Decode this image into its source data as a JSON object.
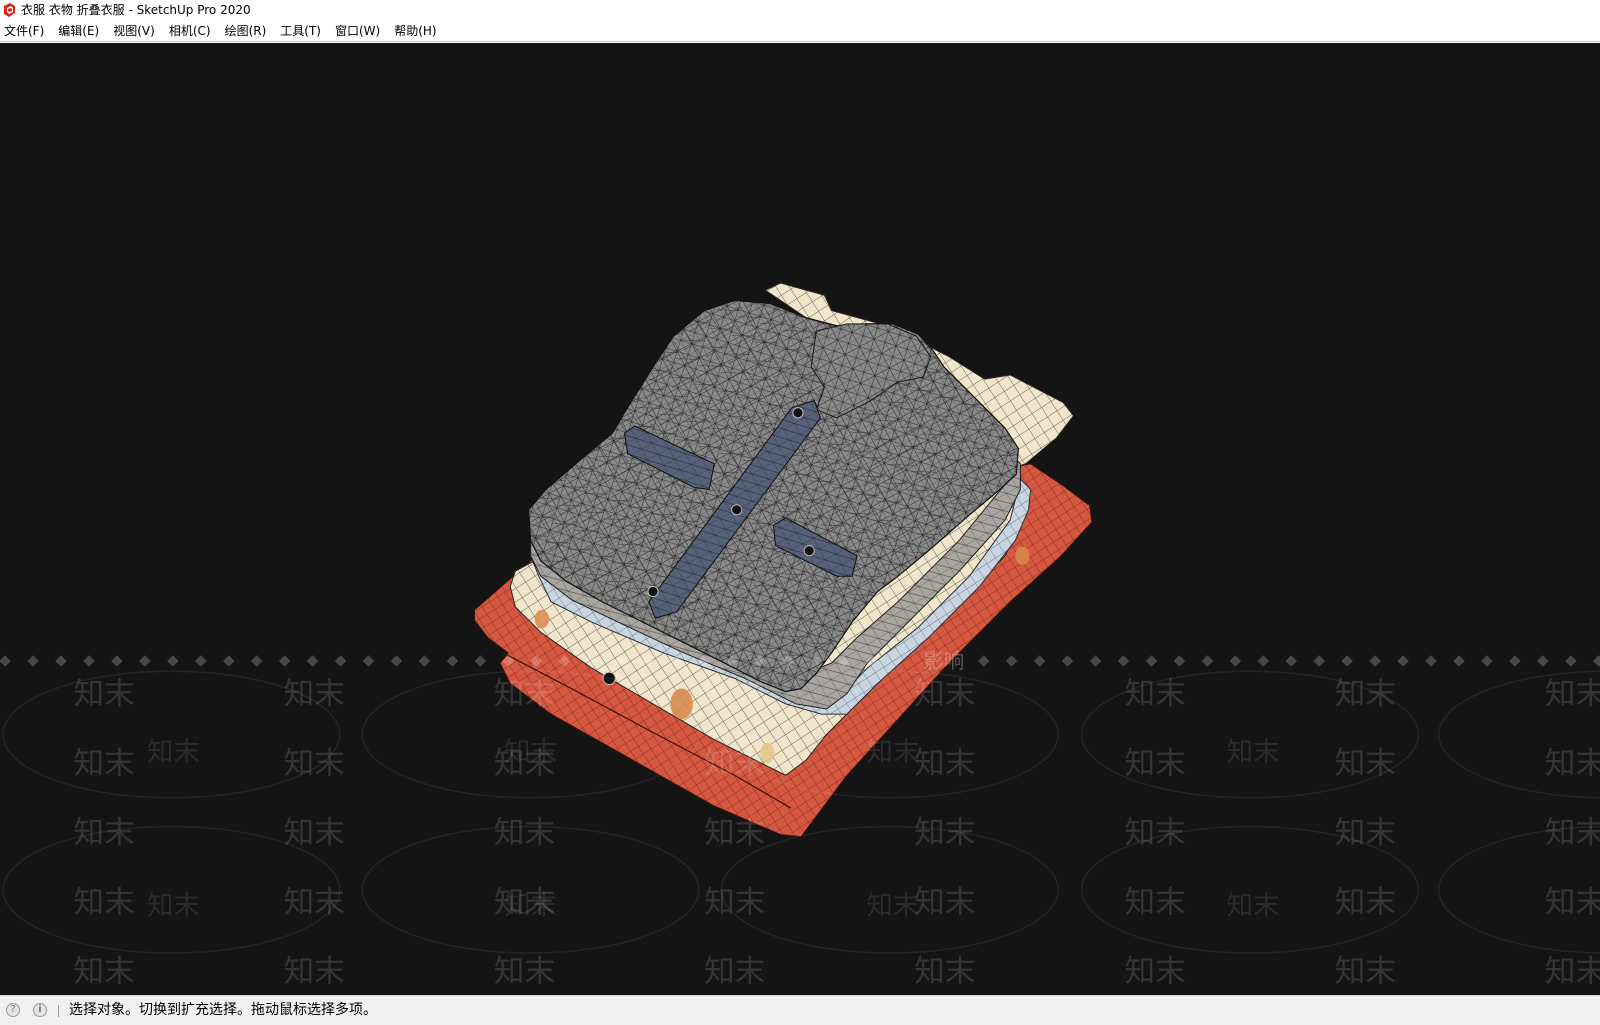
{
  "window": {
    "title": "衣服 衣物 折叠衣服 - SketchUp Pro 2020",
    "icon": "sketchup-logo-icon"
  },
  "menu_bar": {
    "items": [
      "文件(F)",
      "编辑(E)",
      "视图(V)",
      "相机(C)",
      "绘图(R)",
      "工具(T)",
      "窗口(W)",
      "帮助(H)"
    ]
  },
  "status_bar": {
    "icons": [
      "help-icon",
      "info-icon"
    ],
    "message": "选择对象。切换到扩充选择。拖动鼠标选择多项。"
  },
  "watermark": {
    "text": "知末",
    "caption": "影响"
  },
  "colors": {
    "viewport_background": "#141414",
    "status_bar_background": "#f0f0f0",
    "title_bar_background": "#ffffff",
    "app_icon": "#d9261c"
  }
}
